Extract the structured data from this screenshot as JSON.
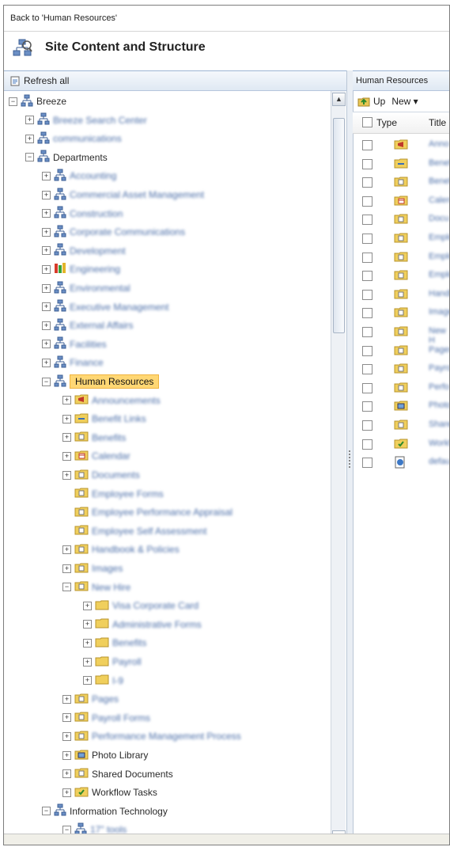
{
  "back_link": "Back to 'Human Resources'",
  "page_title": "Site Content and Structure",
  "left_toolbar": {
    "refresh_label": "Refresh all"
  },
  "tree": [
    {
      "label": "Breeze",
      "indent": 0,
      "expander": "minus",
      "icon": "site"
    },
    {
      "label": "Breeze Search Center",
      "indent": 1,
      "expander": "plus",
      "icon": "site",
      "blurred": true
    },
    {
      "label": "communications",
      "indent": 1,
      "expander": "plus",
      "icon": "site",
      "blurred": true
    },
    {
      "label": "Departments",
      "indent": 1,
      "expander": "minus",
      "icon": "site"
    },
    {
      "label": "Accounting",
      "indent": 2,
      "expander": "plus",
      "icon": "site",
      "blurred": true
    },
    {
      "label": "Commercial Asset Management",
      "indent": 2,
      "expander": "plus",
      "icon": "site",
      "blurred": true
    },
    {
      "label": "Construction",
      "indent": 2,
      "expander": "plus",
      "icon": "site",
      "blurred": true
    },
    {
      "label": "Corporate Communications",
      "indent": 2,
      "expander": "plus",
      "icon": "site",
      "blurred": true
    },
    {
      "label": "Development",
      "indent": 2,
      "expander": "plus",
      "icon": "site",
      "blurred": true
    },
    {
      "label": "Engineering",
      "indent": 2,
      "expander": "plus",
      "icon": "colorsite",
      "blurred": true
    },
    {
      "label": "Environmental",
      "indent": 2,
      "expander": "plus",
      "icon": "site",
      "blurred": true
    },
    {
      "label": "Executive Management",
      "indent": 2,
      "expander": "plus",
      "icon": "site",
      "blurred": true
    },
    {
      "label": "External Affairs",
      "indent": 2,
      "expander": "plus",
      "icon": "site",
      "blurred": true
    },
    {
      "label": "Facilities",
      "indent": 2,
      "expander": "plus",
      "icon": "site",
      "blurred": true
    },
    {
      "label": "Finance",
      "indent": 2,
      "expander": "plus",
      "icon": "site",
      "blurred": true
    },
    {
      "label": "Human Resources",
      "indent": 2,
      "expander": "minus",
      "icon": "site",
      "selected": true
    },
    {
      "label": "Announcements",
      "indent": 3,
      "expander": "plus",
      "icon": "announce",
      "blurred": true
    },
    {
      "label": "Benefit Links",
      "indent": 3,
      "expander": "plus",
      "icon": "links",
      "blurred": true
    },
    {
      "label": "Benefits",
      "indent": 3,
      "expander": "plus",
      "icon": "lib",
      "blurred": true
    },
    {
      "label": "Calendar",
      "indent": 3,
      "expander": "plus",
      "icon": "calendar",
      "blurred": true
    },
    {
      "label": "Documents",
      "indent": 3,
      "expander": "plus",
      "icon": "lib",
      "blurred": true
    },
    {
      "label": "Employee Forms",
      "indent": 3,
      "expander": "none",
      "icon": "lib",
      "blurred": true
    },
    {
      "label": "Employee Performance Appraisal",
      "indent": 3,
      "expander": "none",
      "icon": "lib",
      "blurred": true
    },
    {
      "label": "Employee Self Assessment",
      "indent": 3,
      "expander": "none",
      "icon": "lib",
      "blurred": true
    },
    {
      "label": "Handbook & Policies",
      "indent": 3,
      "expander": "plus",
      "icon": "lib",
      "blurred": true
    },
    {
      "label": "Images",
      "indent": 3,
      "expander": "plus",
      "icon": "lib",
      "blurred": true
    },
    {
      "label": "New Hire",
      "indent": 3,
      "expander": "minus",
      "icon": "lib",
      "blurred": true
    },
    {
      "label": "Visa Corporate Card",
      "indent": 4,
      "expander": "plus",
      "icon": "folder",
      "blurred": true
    },
    {
      "label": "Administrative Forms",
      "indent": 4,
      "expander": "plus",
      "icon": "folder",
      "blurred": true
    },
    {
      "label": "Benefits",
      "indent": 4,
      "expander": "plus",
      "icon": "folder",
      "blurred": true
    },
    {
      "label": "Payroll",
      "indent": 4,
      "expander": "plus",
      "icon": "folder",
      "blurred": true
    },
    {
      "label": "I-9",
      "indent": 4,
      "expander": "plus",
      "icon": "folder",
      "blurred": true
    },
    {
      "label": "Pages",
      "indent": 3,
      "expander": "plus",
      "icon": "lib",
      "blurred": true
    },
    {
      "label": "Payroll Forms",
      "indent": 3,
      "expander": "plus",
      "icon": "lib",
      "blurred": true
    },
    {
      "label": "Performance Management Process",
      "indent": 3,
      "expander": "plus",
      "icon": "lib",
      "blurred": true
    },
    {
      "label": "Photo Library",
      "indent": 3,
      "expander": "plus",
      "icon": "photo"
    },
    {
      "label": "Shared Documents",
      "indent": 3,
      "expander": "plus",
      "icon": "lib"
    },
    {
      "label": "Workflow Tasks",
      "indent": 3,
      "expander": "plus",
      "icon": "tasks"
    },
    {
      "label": "Information Technology",
      "indent": 2,
      "expander": "minus",
      "icon": "site"
    },
    {
      "label": "17\" tools",
      "indent": 3,
      "expander": "minus",
      "icon": "site",
      "blurred": true
    }
  ],
  "right_pane": {
    "header": "Human Resources",
    "up_label": "Up",
    "new_label": "New ▾",
    "col_type": "Type",
    "col_title": "Title",
    "rows": [
      {
        "icon": "announce",
        "title": "Anno"
      },
      {
        "icon": "links",
        "title": "Benef"
      },
      {
        "icon": "lib",
        "title": "Benef"
      },
      {
        "icon": "calendar",
        "title": "Calen"
      },
      {
        "icon": "lib",
        "title": "Docu"
      },
      {
        "icon": "lib",
        "title": "Emplo"
      },
      {
        "icon": "lib",
        "title": "Emplo"
      },
      {
        "icon": "lib",
        "title": "Emplo"
      },
      {
        "icon": "lib",
        "title": "Handb"
      },
      {
        "icon": "lib",
        "title": "Image"
      },
      {
        "icon": "lib",
        "title": "New H"
      },
      {
        "icon": "lib",
        "title": "Pages"
      },
      {
        "icon": "lib",
        "title": "Payro"
      },
      {
        "icon": "lib",
        "title": "Perfo"
      },
      {
        "icon": "photo",
        "title": "Photo"
      },
      {
        "icon": "lib",
        "title": "Share"
      },
      {
        "icon": "tasks",
        "title": "Workf"
      },
      {
        "icon": "aspx",
        "title": "defau"
      }
    ]
  }
}
